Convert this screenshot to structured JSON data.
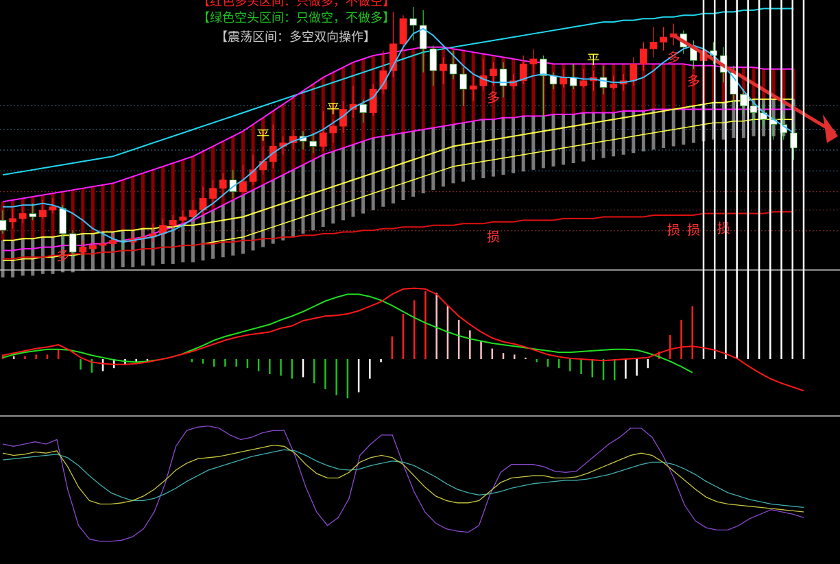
{
  "legend": {
    "red_zone": "【红色多头区间：只做多，不做空】",
    "green_zone": "【绿色空头区间：只做空，不做多】",
    "range_zone": "【震荡区间：多空双向操作】"
  },
  "colors": {
    "background": "#000000",
    "up_candle": "#ff2020",
    "down_candle": "#ffffff",
    "bull_band": "#8b0000",
    "neutral_band": "#7a7a7a",
    "upper_band": "#ff20ff",
    "outer_band": "#20d8f0",
    "ma_yellow": "#ffff40",
    "ma_blue": "#40c0ff",
    "stop_line": "#e01010",
    "macd_dif": "#ff1a1a",
    "macd_dea": "#20e020",
    "kdj_k": "#c8c840",
    "kdj_d": "#40b0b0",
    "kdj_j": "#8a4ad0"
  },
  "signals": {
    "flat": "平",
    "long": "多",
    "stop": "损"
  },
  "chart_data": [
    {
      "type": "candlestick",
      "panel": "main",
      "ohlc": [
        [
          118,
          112,
          124,
          110
        ],
        [
          117,
          119,
          125,
          113
        ],
        [
          119,
          122,
          126,
          116
        ],
        [
          122,
          120,
          128,
          118
        ],
        [
          120,
          124,
          130,
          119
        ],
        [
          124,
          126,
          131,
          122
        ],
        [
          125,
          110,
          127,
          104
        ],
        [
          110,
          99,
          112,
          96
        ],
        [
          99,
          102,
          106,
          97
        ],
        [
          101,
          103,
          105,
          96
        ],
        [
          103,
          104,
          108,
          99
        ],
        [
          104,
          106,
          110,
          102
        ],
        [
          106,
          105,
          109,
          100
        ],
        [
          105,
          107,
          111,
          103
        ],
        [
          107,
          108,
          112,
          104
        ],
        [
          108,
          110,
          116,
          105
        ],
        [
          110,
          115,
          119,
          108
        ],
        [
          115,
          118,
          121,
          113
        ],
        [
          118,
          120,
          124,
          116
        ],
        [
          120,
          124,
          130,
          117
        ],
        [
          124,
          131,
          138,
          121
        ],
        [
          131,
          137,
          142,
          126
        ],
        [
          137,
          142,
          146,
          132
        ],
        [
          142,
          135,
          148,
          131
        ],
        [
          135,
          141,
          151,
          133
        ],
        [
          141,
          148,
          157,
          139
        ],
        [
          148,
          153,
          162,
          145
        ],
        [
          153,
          162,
          175,
          149
        ],
        [
          162,
          164,
          168,
          157
        ],
        [
          164,
          168,
          172,
          160
        ],
        [
          168,
          165,
          171,
          160
        ],
        [
          165,
          162,
          170,
          158
        ],
        [
          162,
          170,
          183,
          159
        ],
        [
          170,
          174,
          178,
          164
        ],
        [
          174,
          184,
          189,
          170
        ],
        [
          184,
          187,
          198,
          179
        ],
        [
          187,
          182,
          190,
          176
        ],
        [
          182,
          196,
          199,
          180
        ],
        [
          196,
          207,
          219,
          193
        ],
        [
          207,
          223,
          242,
          203
        ],
        [
          223,
          238,
          240,
          219
        ],
        [
          238,
          234,
          245,
          225
        ],
        [
          234,
          220,
          243,
          206
        ],
        [
          220,
          207,
          222,
          198
        ],
        [
          207,
          211,
          215,
          199
        ],
        [
          211,
          205,
          219,
          202
        ],
        [
          205,
          196,
          209,
          186
        ],
        [
          196,
          198,
          204,
          189
        ],
        [
          198,
          204,
          214,
          195
        ],
        [
          204,
          208,
          212,
          198
        ],
        [
          208,
          198,
          212,
          191
        ],
        [
          198,
          201,
          205,
          196
        ],
        [
          201,
          211,
          216,
          199
        ],
        [
          211,
          214,
          220,
          205
        ],
        [
          214,
          204,
          216,
          178
        ],
        [
          204,
          199,
          206,
          196
        ],
        [
          199,
          203,
          208,
          197
        ],
        [
          203,
          198,
          211,
          196
        ],
        [
          198,
          201,
          208,
          197
        ],
        [
          201,
          203,
          207,
          195
        ],
        [
          203,
          197,
          210,
          193
        ],
        [
          197,
          199,
          204,
          196
        ],
        [
          199,
          201,
          205,
          195
        ],
        [
          201,
          211,
          215,
          198
        ],
        [
          211,
          220,
          224,
          207
        ],
        [
          220,
          224,
          233,
          215
        ],
        [
          224,
          227,
          233,
          219
        ],
        [
          227,
          229,
          235,
          222
        ],
        [
          229,
          221,
          231,
          217
        ],
        [
          221,
          213,
          225,
          208
        ],
        [
          213,
          219,
          225,
          209
        ],
        [
          219,
          216,
          224,
          211
        ],
        [
          216,
          206,
          221,
          200
        ],
        [
          206,
          193,
          210,
          188
        ],
        [
          193,
          186,
          196,
          181
        ],
        [
          186,
          182,
          188,
          176
        ],
        [
          182,
          178,
          187,
          174
        ],
        [
          178,
          175,
          180,
          166
        ],
        [
          175,
          170,
          181,
          166
        ],
        [
          170,
          161,
          176,
          154
        ]
      ],
      "ma_upper": [
        129,
        130,
        131,
        132,
        133,
        134,
        135,
        136,
        137,
        138,
        139,
        140,
        142,
        144,
        146,
        148,
        150,
        152,
        154,
        156,
        159,
        162,
        165,
        168,
        171,
        175,
        179,
        183,
        187,
        191,
        195,
        199,
        203,
        206,
        209,
        212,
        214,
        216,
        217,
        218,
        219,
        220,
        221,
        221,
        221,
        220,
        219,
        218,
        217,
        216,
        215,
        214,
        213,
        212,
        212,
        211,
        211,
        211,
        211,
        211,
        211,
        211,
        211,
        211,
        211,
        211,
        211,
        211,
        211,
        210,
        210,
        210,
        209,
        209,
        209,
        209,
        208,
        208,
        208,
        208
      ],
      "ma_lower": [
        100,
        100,
        101,
        101,
        102,
        102,
        103,
        103,
        103,
        104,
        104,
        105,
        106,
        107,
        108,
        110,
        112,
        114,
        116,
        118,
        121,
        124,
        127,
        130,
        133,
        136,
        139,
        142,
        145,
        148,
        151,
        154,
        157,
        159,
        161,
        163,
        165,
        167,
        168,
        169,
        170,
        171,
        172,
        173,
        174,
        175,
        176,
        177,
        178,
        178,
        179,
        179,
        180,
        180,
        180,
        181,
        181,
        181,
        182,
        182,
        182,
        182,
        183,
        183,
        183,
        184,
        184,
        184,
        184,
        184,
        184,
        184,
        184,
        184,
        184,
        184,
        184,
        184,
        184,
        184
      ],
      "outer_band": [
        145,
        146,
        147,
        148,
        149,
        150,
        151,
        152,
        153,
        154,
        155,
        156,
        158,
        160,
        162,
        164,
        166,
        168,
        170,
        172,
        174,
        176,
        178,
        180,
        182,
        184,
        186,
        188,
        190,
        192,
        194,
        196,
        198,
        200,
        202,
        204,
        206,
        208,
        210,
        212,
        214,
        216,
        218,
        219,
        220,
        221,
        222,
        223,
        224,
        225,
        226,
        227,
        228,
        229,
        230,
        231,
        232,
        233,
        234,
        235,
        236,
        236,
        237,
        237,
        238,
        238,
        239,
        239,
        240,
        240,
        241,
        241,
        242,
        242,
        243,
        243,
        244,
        244,
        244,
        244
      ],
      "ma_blue": [
        126,
        126,
        127,
        127,
        128,
        127,
        125,
        122,
        118,
        113,
        110,
        107,
        105,
        106,
        107,
        108,
        110,
        112,
        115,
        119,
        124,
        128,
        133,
        138,
        142,
        147,
        153,
        158,
        162,
        165,
        167,
        169,
        172,
        176,
        180,
        185,
        188,
        191,
        199,
        210,
        221,
        229,
        232,
        228,
        222,
        216,
        210,
        205,
        202,
        200,
        200,
        200,
        202,
        204,
        205,
        204,
        203,
        203,
        202,
        202,
        201,
        200,
        200,
        201,
        203,
        207,
        212,
        216,
        220,
        222,
        220,
        216,
        210,
        203,
        195,
        188,
        182,
        178,
        174,
        170
      ],
      "ma_yellow": [
        106,
        106,
        107,
        107,
        108,
        108,
        109,
        109,
        110,
        110,
        111,
        111,
        112,
        112,
        113,
        113,
        114,
        114,
        115,
        115,
        116,
        117,
        118,
        119,
        120,
        122,
        124,
        126,
        128,
        130,
        132,
        134,
        136,
        138,
        140,
        142,
        144,
        146,
        148,
        150,
        152,
        154,
        156,
        158,
        160,
        162,
        163,
        164,
        165,
        166,
        167,
        168,
        169,
        170,
        171,
        172,
        173,
        174,
        175,
        176,
        177,
        178,
        179,
        180,
        181,
        182,
        183,
        184,
        185,
        186,
        187,
        188,
        188,
        189,
        189,
        190,
        190,
        190,
        190,
        190
      ],
      "stop_line": [
        95,
        95,
        96,
        96,
        96,
        97,
        97,
        98,
        98,
        98,
        99,
        99,
        100,
        100,
        101,
        101,
        102,
        102,
        103,
        103,
        104,
        104,
        105,
        105,
        106,
        106,
        107,
        107,
        108,
        108,
        109,
        109,
        110,
        110,
        111,
        111,
        112,
        112,
        113,
        113,
        114,
        114,
        114,
        115,
        115,
        115,
        116,
        116,
        116,
        117,
        117,
        117,
        118,
        118,
        118,
        118,
        119,
        119,
        119,
        119,
        120,
        120,
        120,
        120,
        120,
        121,
        121,
        121,
        121,
        121,
        122,
        122,
        122,
        122,
        122,
        122,
        122,
        123,
        123,
        123
      ],
      "markers": [
        {
          "index": 26,
          "label": "平"
        },
        {
          "index": 33,
          "label": "平"
        },
        {
          "index": 59,
          "label": "平"
        },
        {
          "index": 6,
          "label": "多"
        },
        {
          "index": 49,
          "label": "多"
        },
        {
          "index": 67,
          "label": "多"
        },
        {
          "index": 69,
          "label": "多"
        },
        {
          "index": 49,
          "label": "损"
        },
        {
          "index": 67,
          "label": "损"
        },
        {
          "index": 69,
          "label": "损"
        },
        {
          "index": 72,
          "label": "损"
        }
      ]
    },
    {
      "type": "macd",
      "panel": "macd",
      "dif": [
        0.5,
        0.8,
        1.1,
        1.4,
        1.6,
        1.9,
        1.2,
        0.2,
        -0.4,
        -0.6,
        -0.7,
        -0.7,
        -0.6,
        -0.4,
        -0.1,
        0.2,
        0.6,
        1.0,
        1.5,
        2.0,
        2.5,
        2.9,
        3.2,
        3.4,
        3.6,
        4.1,
        4.4,
        5.1,
        5.4,
        5.7,
        5.8,
        6.0,
        6.4,
        7.0,
        7.6,
        8.6,
        9.3,
        9.4,
        9.3,
        8.6,
        7.1,
        5.7,
        4.6,
        3.6,
        2.8,
        2.3,
        2.0,
        1.6,
        1.1,
        0.6,
        0.3,
        0.1,
        0.0,
        -0.1,
        -0.2,
        -0.1,
        0.0,
        0.1,
        0.2,
        0.8,
        1.3,
        1.6,
        1.7,
        1.5,
        1.2,
        0.7,
        0.1,
        -0.9,
        -1.8,
        -2.6,
        -3.2,
        -3.7,
        -4.2
      ],
      "dea": [
        0.2,
        0.6,
        0.9,
        1.1,
        1.3,
        1.3,
        1.2,
        0.9,
        0.5,
        0.2,
        -0.1,
        -0.3,
        -0.4,
        -0.3,
        -0.1,
        0.2,
        0.6,
        1.2,
        1.8,
        2.5,
        3.0,
        3.4,
        3.8,
        4.2,
        4.6,
        5.2,
        5.7,
        6.3,
        7.0,
        7.7,
        8.2,
        8.6,
        8.6,
        8.3,
        7.8,
        7.1,
        6.3,
        5.5,
        4.8,
        4.2,
        3.6,
        3.1,
        2.7,
        2.4,
        2.1,
        1.9,
        1.7,
        1.5,
        1.3,
        1.1,
        0.9,
        0.9,
        1.0,
        1.1,
        1.2,
        1.3,
        1.3,
        1.2,
        0.8,
        0.3,
        -0.3,
        -1.0,
        -1.8
      ]
    },
    {
      "type": "line",
      "panel": "kdj",
      "k": [
        72,
        70,
        71,
        73,
        72,
        74,
        60,
        42,
        30,
        27,
        27,
        28,
        30,
        34,
        40,
        48,
        57,
        63,
        67,
        68,
        69,
        71,
        73,
        75,
        77,
        79,
        78,
        72,
        62,
        54,
        50,
        50,
        55,
        64,
        68,
        70,
        68,
        62,
        52,
        42,
        34,
        30,
        28,
        28,
        30,
        38,
        46,
        50,
        51,
        52,
        52,
        50,
        50,
        51,
        54,
        58,
        62,
        66,
        70,
        72,
        70,
        64,
        56,
        48,
        40,
        33,
        29,
        27,
        26,
        25,
        24,
        23,
        22,
        21,
        20
      ],
      "d": [
        66,
        67,
        68,
        69,
        70,
        71,
        68,
        61,
        52,
        44,
        37,
        33,
        30,
        30,
        32,
        36,
        41,
        47,
        52,
        57,
        60,
        63,
        66,
        69,
        71,
        73,
        75,
        74,
        70,
        65,
        61,
        58,
        57,
        58,
        61,
        63,
        65,
        64,
        61,
        56,
        51,
        45,
        40,
        37,
        35,
        36,
        38,
        41,
        43,
        45,
        46,
        47,
        48,
        48,
        49,
        51,
        53,
        56,
        59,
        62,
        64,
        64,
        62,
        58,
        53,
        47,
        42,
        37,
        34,
        31,
        29,
        27,
        26,
        25,
        24
      ],
      "j": [
        80,
        78,
        80,
        82,
        80,
        84,
        40,
        8,
        -4,
        -6,
        -6,
        -5,
        -2,
        5,
        20,
        45,
        78,
        92,
        95,
        96,
        94,
        88,
        84,
        86,
        90,
        92,
        92,
        70,
        42,
        20,
        8,
        15,
        32,
        70,
        80,
        88,
        88,
        62,
        38,
        20,
        10,
        5,
        3,
        2,
        8,
        35,
        55,
        62,
        62,
        62,
        60,
        56,
        55,
        56,
        64,
        72,
        80,
        86,
        94,
        94,
        86,
        70,
        50,
        26,
        12,
        6,
        4,
        4,
        8,
        14,
        18,
        22,
        20,
        18,
        15
      ]
    }
  ]
}
